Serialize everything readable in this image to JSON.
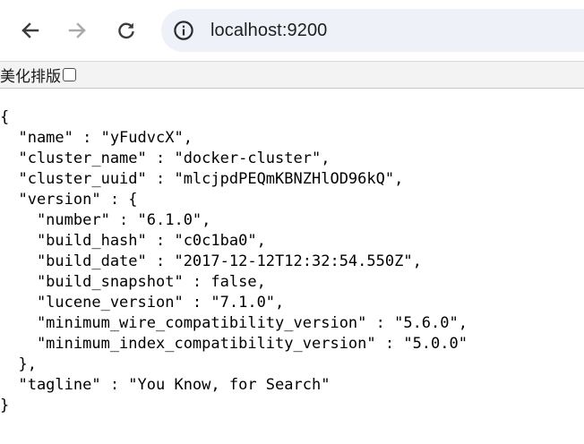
{
  "browser": {
    "url": "localhost:9200",
    "icons": {
      "back": "arrow-left-icon",
      "forward": "arrow-right-icon",
      "reload": "reload-icon",
      "site_info": "info-circle-icon"
    }
  },
  "viewer": {
    "pretty_print_label": "美化排版",
    "pretty_print_checked": false
  },
  "json_lines": [
    "{",
    "  \"name\" : \"yFudvcX\",",
    "  \"cluster_name\" : \"docker-cluster\",",
    "  \"cluster_uuid\" : \"mlcjpdPEQmKBNZHlOD96kQ\",",
    "  \"version\" : {",
    "    \"number\" : \"6.1.0\",",
    "    \"build_hash\" : \"c0c1ba0\",",
    "    \"build_date\" : \"2017-12-12T12:32:54.550Z\",",
    "    \"build_snapshot\" : false,",
    "    \"lucene_version\" : \"7.1.0\",",
    "    \"minimum_wire_compatibility_version\" : \"5.6.0\",",
    "    \"minimum_index_compatibility_version\" : \"5.0.0\"",
    "  },",
    "  \"tagline\" : \"You Know, for Search\"",
    "}"
  ]
}
